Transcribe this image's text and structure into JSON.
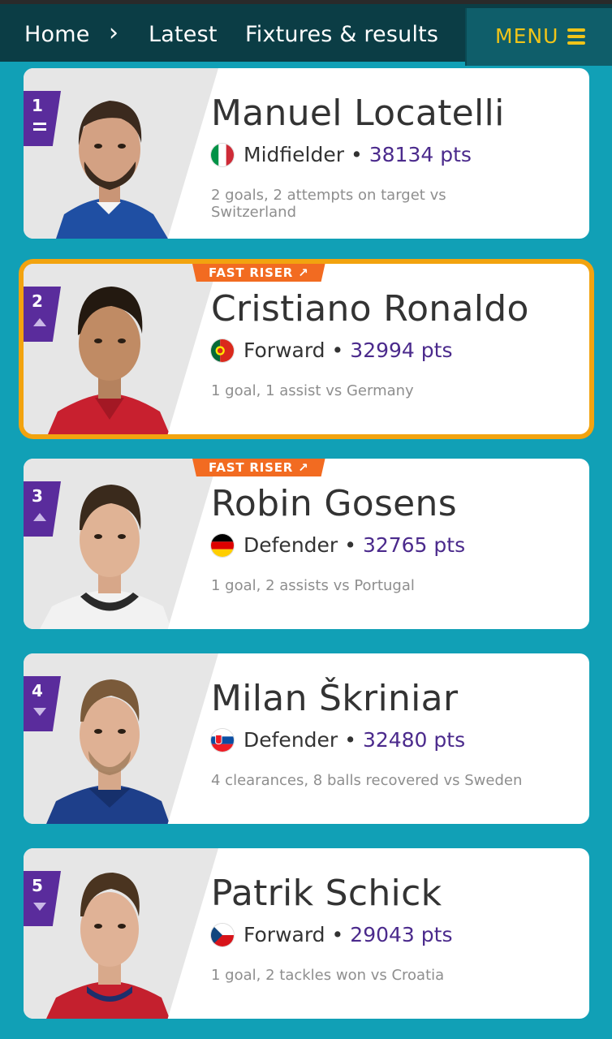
{
  "nav": {
    "home": "Home",
    "chevron": "›",
    "latest": "Latest",
    "fixtures": "Fixtures & results",
    "menu_label": "MENU"
  },
  "colors": {
    "background": "#11a0b6",
    "topbar": "#0b3d45",
    "menu_accent": "#f0c419",
    "rank_badge": "#5a2c9c",
    "points": "#4b2a8c",
    "fast_riser": "#f26b21",
    "highlight_border": "#f2a30f"
  },
  "players": [
    {
      "rank": "1",
      "trend": "same",
      "name": "Manuel Locatelli",
      "flag": "italy",
      "position": "Midfielder",
      "points": "38134 pts",
      "description": "2 goals, 2 attempts on target vs Switzerland",
      "fast_riser": "",
      "highlighted": false
    },
    {
      "rank": "2",
      "trend": "up",
      "name": "Cristiano Ronaldo",
      "flag": "portugal",
      "position": "Forward",
      "points": "32994 pts",
      "description": "1 goal, 1 assist vs Germany",
      "fast_riser": "FAST RISER ↗",
      "highlighted": true
    },
    {
      "rank": "3",
      "trend": "up",
      "name": "Robin Gosens",
      "flag": "germany",
      "position": "Defender",
      "points": "32765 pts",
      "description": "1 goal, 2 assists vs Portugal",
      "fast_riser": "FAST RISER ↗",
      "highlighted": false
    },
    {
      "rank": "4",
      "trend": "down",
      "name": "Milan Škriniar",
      "flag": "slovakia",
      "position": "Defender",
      "points": "32480 pts",
      "description": "4 clearances, 8 balls recovered vs Sweden",
      "fast_riser": "",
      "highlighted": false
    },
    {
      "rank": "5",
      "trend": "down",
      "name": "Patrik Schick",
      "flag": "czech-republic",
      "position": "Forward",
      "points": "29043 pts",
      "description": "1 goal, 2 tackles won vs Croatia",
      "fast_riser": "",
      "highlighted": false
    }
  ]
}
